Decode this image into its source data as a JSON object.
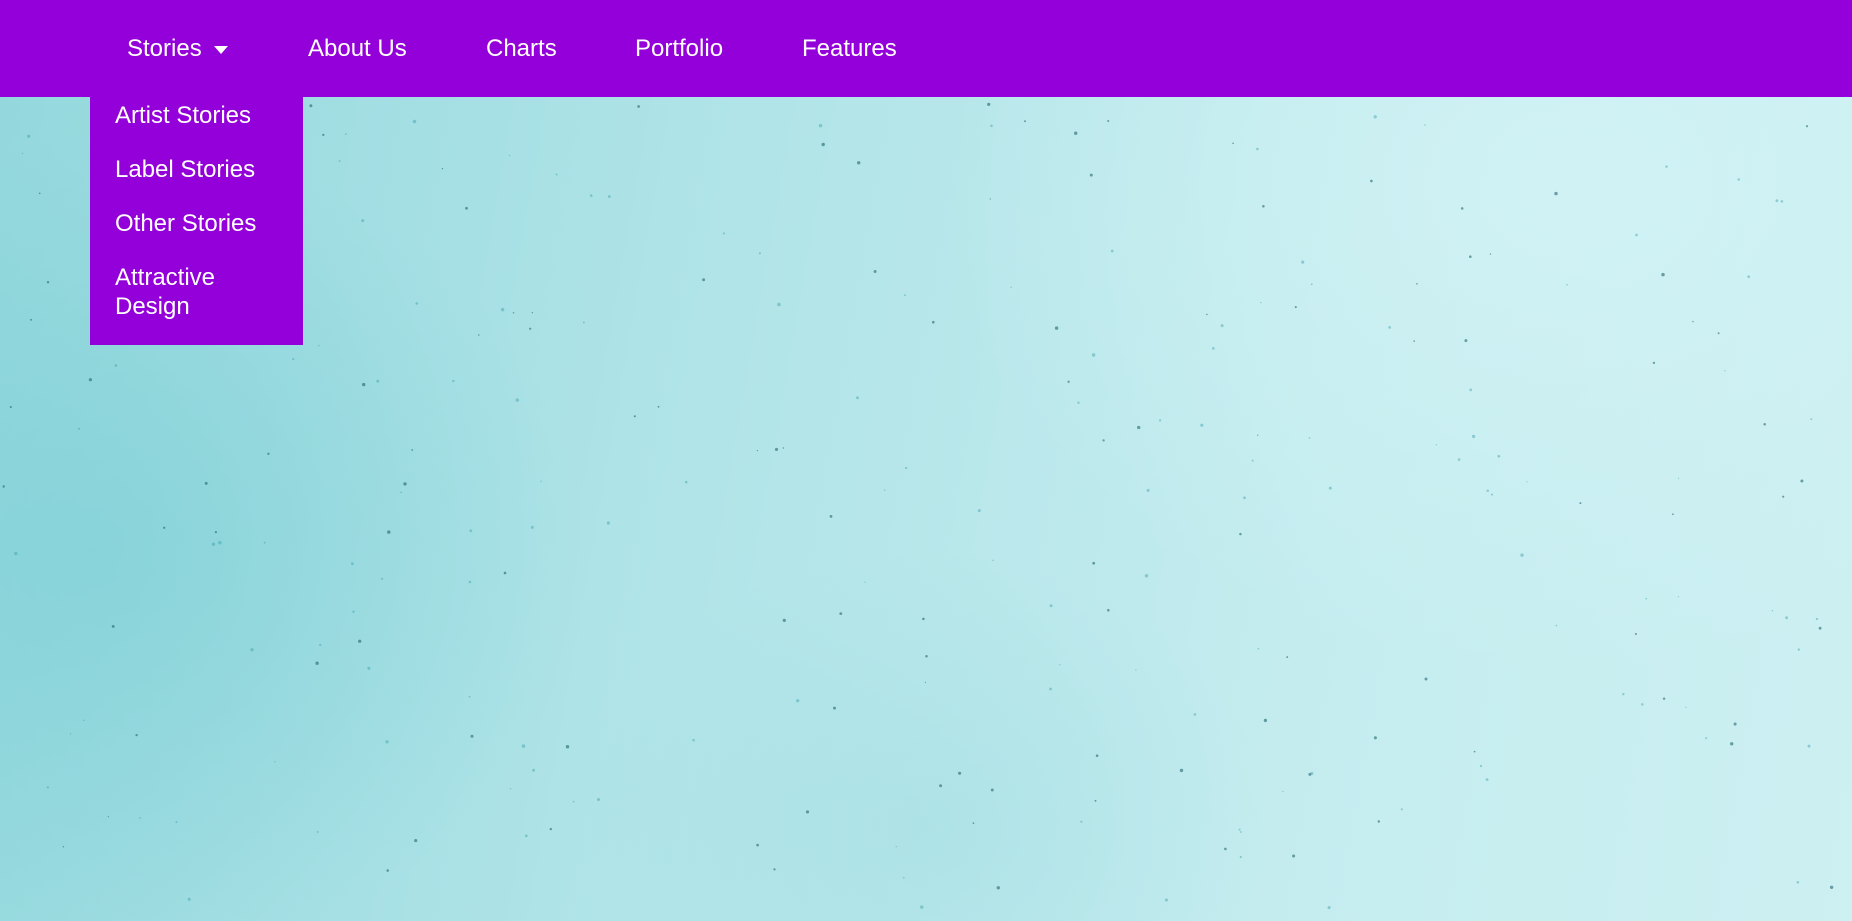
{
  "colors": {
    "navbar_bg": "#9400d9",
    "nav_text": "#ffffff",
    "page_bg": "#bde9ec"
  },
  "nav": {
    "items": [
      {
        "label": "Stories",
        "has_dropdown": true,
        "icon": "caret-down-icon"
      },
      {
        "label": "About Us"
      },
      {
        "label": "Charts"
      },
      {
        "label": "Portfolio"
      },
      {
        "label": "Features"
      }
    ]
  },
  "dropdown": {
    "open_under": "Stories",
    "items": [
      {
        "label": "Artist Stories"
      },
      {
        "label": "Label Stories"
      },
      {
        "label": "Other Stories"
      },
      {
        "label": "Attractive Design"
      }
    ]
  }
}
